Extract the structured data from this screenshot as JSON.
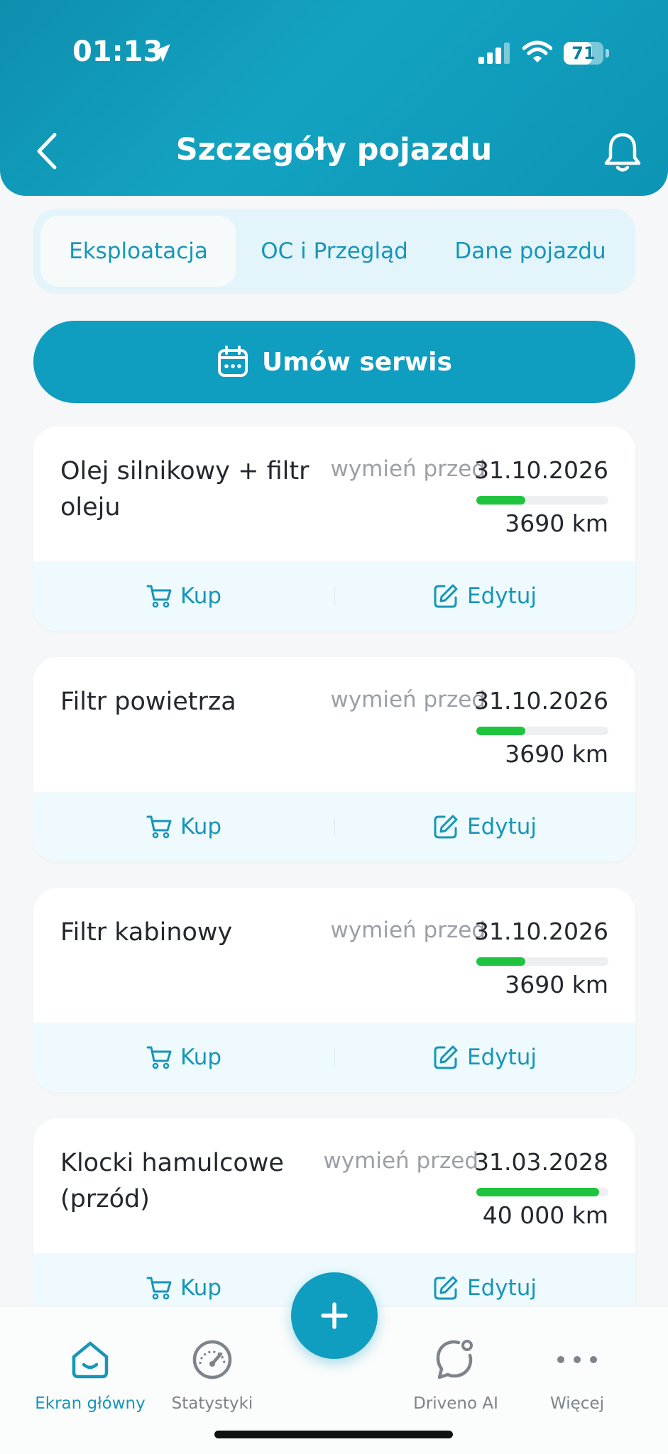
{
  "status_bar": {
    "time": "01:13",
    "battery": "71",
    "battery_level": 0.71
  },
  "header": {
    "title": "Szczegóły pojazdu"
  },
  "tabs": [
    {
      "label": "Eksploatacja",
      "active": true
    },
    {
      "label": "OC i Przegląd",
      "active": false
    },
    {
      "label": "Dane pojazdu",
      "active": false
    }
  ],
  "cta": {
    "label": "Umów serwis"
  },
  "cards": [
    {
      "name": "Olej silnikowy + filtr oleju",
      "due_label": "wymień przed",
      "date": "31.10.2026",
      "km": "3690 km",
      "progress": 0.37,
      "buy": "Kup",
      "edit": "Edytuj"
    },
    {
      "name": "Filtr powietrza",
      "due_label": "wymień przed",
      "date": "31.10.2026",
      "km": "3690 km",
      "progress": 0.37,
      "buy": "Kup",
      "edit": "Edytuj"
    },
    {
      "name": "Filtr kabinowy",
      "due_label": "wymień przed",
      "date": "31.10.2026",
      "km": "3690 km",
      "progress": 0.37,
      "buy": "Kup",
      "edit": "Edytuj"
    },
    {
      "name": "Klocki hamulcowe (przód)",
      "due_label": "wymień przed",
      "date": "31.03.2028",
      "km": "40 000 km",
      "progress": 0.93,
      "buy": "Kup",
      "edit": "Edytuj"
    }
  ],
  "bottom_nav": [
    {
      "label": "Ekran główny",
      "icon": "home-icon",
      "active": true
    },
    {
      "label": "Statystyki",
      "icon": "gauge-icon",
      "active": false
    },
    {
      "label": "Driveno AI",
      "icon": "chat-bubble-icon",
      "active": false
    },
    {
      "label": "Więcej",
      "icon": "more-dots-icon",
      "active": false
    }
  ],
  "colors": {
    "accent": "#0f9dc0",
    "progress": "#1fc43e",
    "header": "#13a3c1"
  }
}
